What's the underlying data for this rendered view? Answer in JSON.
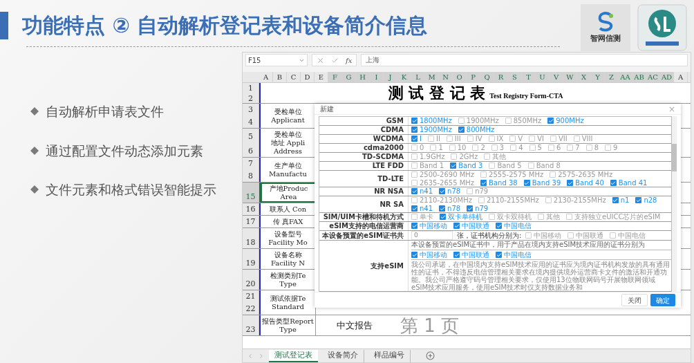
{
  "slide": {
    "title": "功能特点 ② 自动解析登记表和设备简介信息",
    "logo_caption": "智网信测"
  },
  "bullets": [
    "自动解析申请表文件",
    "通过配置文件动态添加元素",
    "文件元素和格式错误智能提示"
  ],
  "spreadsheet": {
    "name_box": "F15",
    "fx": "fx",
    "formula": "上海",
    "columns": [
      {
        "label": "A",
        "selected": false
      },
      {
        "label": "B",
        "selected": false
      },
      {
        "label": "C",
        "selected": false
      },
      {
        "label": "D",
        "selected": false
      },
      {
        "label": "E",
        "selected": false
      },
      {
        "label": "F",
        "selected": true
      },
      {
        "label": "G",
        "selected": true
      },
      {
        "label": "H",
        "selected": true
      },
      {
        "label": "I",
        "selected": true
      },
      {
        "label": "J",
        "selected": true
      },
      {
        "label": "K",
        "selected": true
      },
      {
        "label": "L",
        "selected": true
      },
      {
        "label": "M",
        "selected": true
      },
      {
        "label": "N",
        "selected": true
      },
      {
        "label": "O",
        "selected": true
      },
      {
        "label": "P",
        "selected": true
      },
      {
        "label": "Q",
        "selected": true
      },
      {
        "label": "R",
        "selected": true
      },
      {
        "label": "S",
        "selected": true
      },
      {
        "label": "T",
        "selected": true
      },
      {
        "label": "U",
        "selected": true
      },
      {
        "label": "V",
        "selected": true
      },
      {
        "label": "W",
        "selected": true
      },
      {
        "label": "X",
        "selected": true
      },
      {
        "label": "Y",
        "selected": true
      },
      {
        "label": "Z",
        "selected": true
      },
      {
        "label": "AA",
        "selected": true
      },
      {
        "label": "AB",
        "selected": true
      },
      {
        "label": "AC",
        "selected": true
      },
      {
        "label": "AD",
        "selected": true
      },
      {
        "label": "A",
        "selected": false
      }
    ],
    "title_rows": [
      "1",
      "2"
    ],
    "title": "测 试 登 记 表",
    "title_en": "Test Registry Form-CTA",
    "rows": [
      {
        "numbers": [
          "3",
          "4"
        ],
        "lines": [
          "受检单位",
          "Applicant"
        ],
        "selected": false
      },
      {
        "numbers": [
          "5",
          "6"
        ],
        "lines": [
          "受检单位",
          "地址 Appli",
          "Address"
        ],
        "selected": false
      },
      {
        "numbers": [
          "7",
          "8"
        ],
        "lines": [
          "生产单位",
          "Manufactu"
        ],
        "selected": false
      },
      {
        "numbers": [
          "15"
        ],
        "lines": [
          "产地Produc",
          "Area"
        ],
        "selected": true
      },
      {
        "numbers": [
          "16"
        ],
        "lines": [
          "联系人 Con"
        ],
        "selected": false
      },
      {
        "numbers": [
          "17"
        ],
        "lines": [
          "传 真FAX"
        ],
        "selected": false
      },
      {
        "numbers": [
          "18"
        ],
        "lines": [
          "设备型号",
          "Facility Mo"
        ],
        "selected": false
      },
      {
        "numbers": [
          "19"
        ],
        "lines": [
          "设备名称",
          "Facility N"
        ],
        "selected": false
      },
      {
        "numbers": [
          "20"
        ],
        "lines": [
          "检测类别Te",
          "Type"
        ],
        "selected": false
      },
      {
        "numbers": [
          "21",
          "22"
        ],
        "lines": [
          "测试依据Te",
          "Standard"
        ],
        "selected": false
      },
      {
        "numbers": [
          "23"
        ],
        "lines": [
          "报告类型Report",
          "Type"
        ],
        "selected": false,
        "value": "中文报告",
        "watermark": "第 1 页"
      }
    ],
    "sheet_tabs": [
      {
        "label": "测试登记表",
        "selected": true
      },
      {
        "label": "设备简介",
        "selected": false
      },
      {
        "label": "样品编号",
        "selected": false
      }
    ]
  },
  "dialog": {
    "title": "新建",
    "close": "×",
    "rows": [
      {
        "kind": "options",
        "label": "GSM",
        "options": [
          {
            "label": "1800MHz",
            "checked": true
          },
          {
            "label": "1900MHz",
            "checked": false
          },
          {
            "label": "850MHz",
            "checked": false
          },
          {
            "label": "900MHz",
            "checked": true
          }
        ]
      },
      {
        "kind": "options",
        "label": "CDMA",
        "options": [
          {
            "label": "1900MHz",
            "checked": true
          },
          {
            "label": "800MHz",
            "checked": true
          }
        ]
      },
      {
        "kind": "options",
        "label": "WCDMA",
        "options": [
          {
            "label": "I",
            "checked": true
          },
          {
            "label": "II",
            "checked": false
          },
          {
            "label": "III",
            "checked": false
          },
          {
            "label": "IV",
            "checked": false
          },
          {
            "label": "IX",
            "checked": false
          },
          {
            "label": "V",
            "checked": false
          },
          {
            "label": "VI",
            "checked": false
          },
          {
            "label": "VII",
            "checked": false
          },
          {
            "label": "VIII",
            "checked": false
          }
        ]
      },
      {
        "kind": "options",
        "label": "cdma2000",
        "options": [
          {
            "label": "0",
            "checked": false
          },
          {
            "label": "1",
            "checked": false
          },
          {
            "label": "10",
            "checked": false
          },
          {
            "label": "2",
            "checked": false
          },
          {
            "label": "3",
            "checked": false
          },
          {
            "label": "4",
            "checked": false
          },
          {
            "label": "5",
            "checked": false
          },
          {
            "label": "6",
            "checked": false
          },
          {
            "label": "7",
            "checked": false
          },
          {
            "label": "8",
            "checked": false
          },
          {
            "label": "9",
            "checked": false
          }
        ]
      },
      {
        "kind": "options",
        "label": "TD-SCDMA",
        "options": [
          {
            "label": "1.9GHz",
            "checked": false
          },
          {
            "label": "2GHz",
            "checked": false
          },
          {
            "label": "其他",
            "checked": false
          }
        ]
      },
      {
        "kind": "options",
        "label": "LTE FDD",
        "options": [
          {
            "label": "Band 1",
            "checked": false
          },
          {
            "label": "Band 3",
            "checked": true
          },
          {
            "label": "Band 5",
            "checked": false
          },
          {
            "label": "Band 8",
            "checked": false
          }
        ]
      },
      {
        "kind": "options",
        "label": "TD-LTE",
        "options": [
          {
            "label": "2500-2690 MHz",
            "checked": false
          },
          {
            "label": "2555-2575 MHz",
            "checked": false
          },
          {
            "label": "2575-2635 MHz",
            "checked": false
          },
          {
            "label": "2635-2655 MHz",
            "checked": false
          },
          {
            "label": "Band 38",
            "checked": true
          },
          {
            "label": "Band 39",
            "checked": true
          },
          {
            "label": "Band 40",
            "checked": true
          },
          {
            "label": "Band 41",
            "checked": true
          }
        ]
      },
      {
        "kind": "options",
        "label": "NR NSA",
        "options": [
          {
            "label": "n41",
            "checked": true
          },
          {
            "label": "n78",
            "checked": true
          },
          {
            "label": "n79",
            "checked": false
          }
        ]
      },
      {
        "kind": "options",
        "label": "NR SA",
        "options": [
          {
            "label": "2110-2130MHz",
            "checked": false
          },
          {
            "label": "2110-2155MHz",
            "checked": false
          },
          {
            "label": "2130-2155MHz",
            "checked": false
          },
          {
            "label": "n1",
            "checked": true
          },
          {
            "label": "n28",
            "checked": true
          },
          {
            "label": "n41",
            "checked": true
          },
          {
            "label": "n78",
            "checked": true
          },
          {
            "label": "n79",
            "checked": true
          }
        ]
      },
      {
        "kind": "options",
        "label": "SIM/UIM卡槽和待机方式",
        "options": [
          {
            "label": "单卡",
            "checked": false
          },
          {
            "label": "双卡单待机",
            "checked": true
          },
          {
            "label": "双卡双待机",
            "checked": false
          },
          {
            "label": "其他",
            "checked": false
          },
          {
            "label": "支持独立eUICC芯片的eSIM",
            "checked": false
          }
        ]
      },
      {
        "kind": "options",
        "label": "eSIM支持的电信运营商",
        "options": [
          {
            "label": "中国移动",
            "checked": true
          },
          {
            "label": "中国联通",
            "checked": true
          },
          {
            "label": "中国电信",
            "checked": true
          }
        ]
      },
      {
        "kind": "count",
        "label": "本设备预置的eSIM证书共",
        "value": "0",
        "suffix": "张，证书机构分别为:",
        "options": [
          {
            "label": "中国移动",
            "checked": false
          },
          {
            "label": "中国联通",
            "checked": false
          },
          {
            "label": "中国电信",
            "checked": false
          }
        ]
      },
      {
        "kind": "esim",
        "label": "支持eSIM",
        "note": "本设备预置的eSIM证书中，用于产品在境内支持eSIM技术应用的证书分别为",
        "options": [
          {
            "label": "中国移动",
            "checked": true
          },
          {
            "label": "中国联通",
            "checked": true
          },
          {
            "label": "中国电信",
            "checked": true
          }
        ],
        "commitment": "我公司承诺，在中国境内支持eSIM技术应用的证书应为境内证书机构发放的具有通用性的证书，不得违反电信管理相关要求在境内提供境外运营商卡文件的激活和开通功能。我公司严格遵守码号管理相关要求，仅使用13位物联网码号开展物联网领域eSIM技术应用服务，使用eSIM技术时仅支持数据业务和"
      }
    ],
    "buttons": [
      {
        "label": "关闭",
        "primary": false
      },
      {
        "label": "确定",
        "primary": true
      }
    ]
  }
}
